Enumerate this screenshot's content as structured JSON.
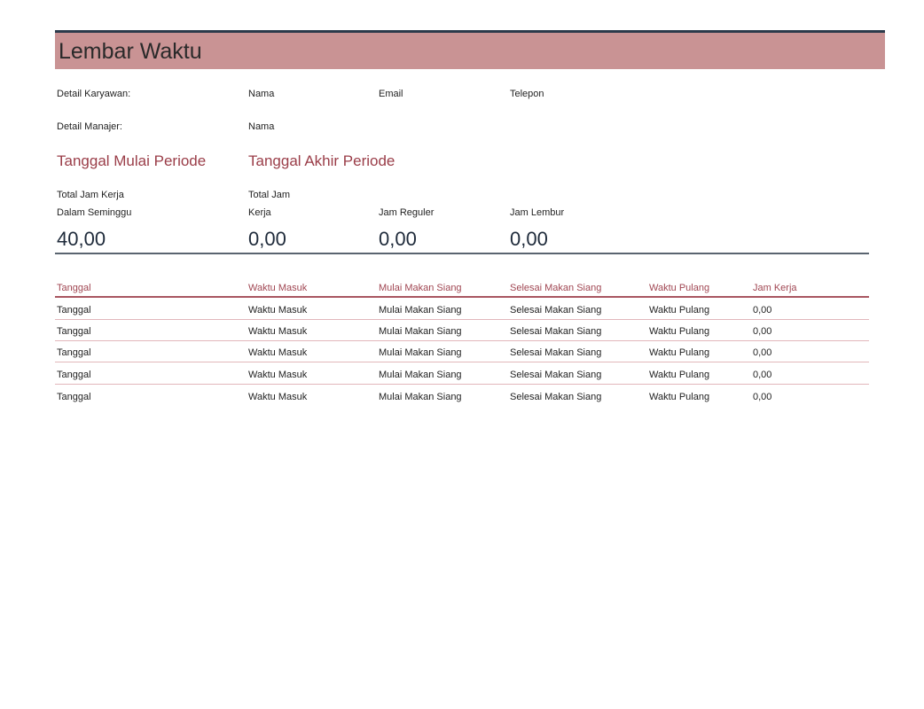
{
  "title": "Lembar Waktu",
  "employee": {
    "label": "Detail Karyawan:",
    "name": "Nama",
    "email": "Email",
    "phone": "Telepon"
  },
  "manager": {
    "label": "Detail Manajer:",
    "name": "Nama"
  },
  "period": {
    "start": "Tanggal Mulai Periode",
    "end": "Tanggal Akhir Periode"
  },
  "summary": {
    "weekly_label_1": "Total Jam Kerja",
    "weekly_label_2": "Dalam Seminggu",
    "weekly_value": "40,00",
    "total_label_1": "Total Jam",
    "total_label_2": "Kerja",
    "total_value": "0,00",
    "regular_label": "Jam Reguler",
    "regular_value": "0,00",
    "overtime_label": "Jam Lembur",
    "overtime_value": "0,00"
  },
  "table": {
    "headers": [
      "Tanggal",
      "Waktu Masuk",
      "Mulai Makan Siang",
      "Selesai Makan Siang",
      "Waktu Pulang",
      "Jam Kerja"
    ],
    "rows": [
      [
        "Tanggal",
        "Waktu Masuk",
        "Mulai Makan Siang",
        "Selesai Makan Siang",
        "Waktu Pulang",
        "0,00"
      ],
      [
        "Tanggal",
        "Waktu Masuk",
        "Mulai Makan Siang",
        "Selesai Makan Siang",
        "Waktu Pulang",
        "0,00"
      ],
      [
        "Tanggal",
        "Waktu Masuk",
        "Mulai Makan Siang",
        "Selesai Makan Siang",
        "Waktu Pulang",
        "0,00"
      ],
      [
        "Tanggal",
        "Waktu Masuk",
        "Mulai Makan Siang",
        "Selesai Makan Siang",
        "Waktu Pulang",
        "0,00"
      ],
      [
        "Tanggal",
        "Waktu Masuk",
        "Mulai Makan Siang",
        "Selesai Makan Siang",
        "Waktu Pulang",
        "0,00"
      ]
    ]
  },
  "colors": {
    "title_fill": "#c99394",
    "accent": "#9a3d48",
    "rule_dark": "#2b3a4a"
  }
}
